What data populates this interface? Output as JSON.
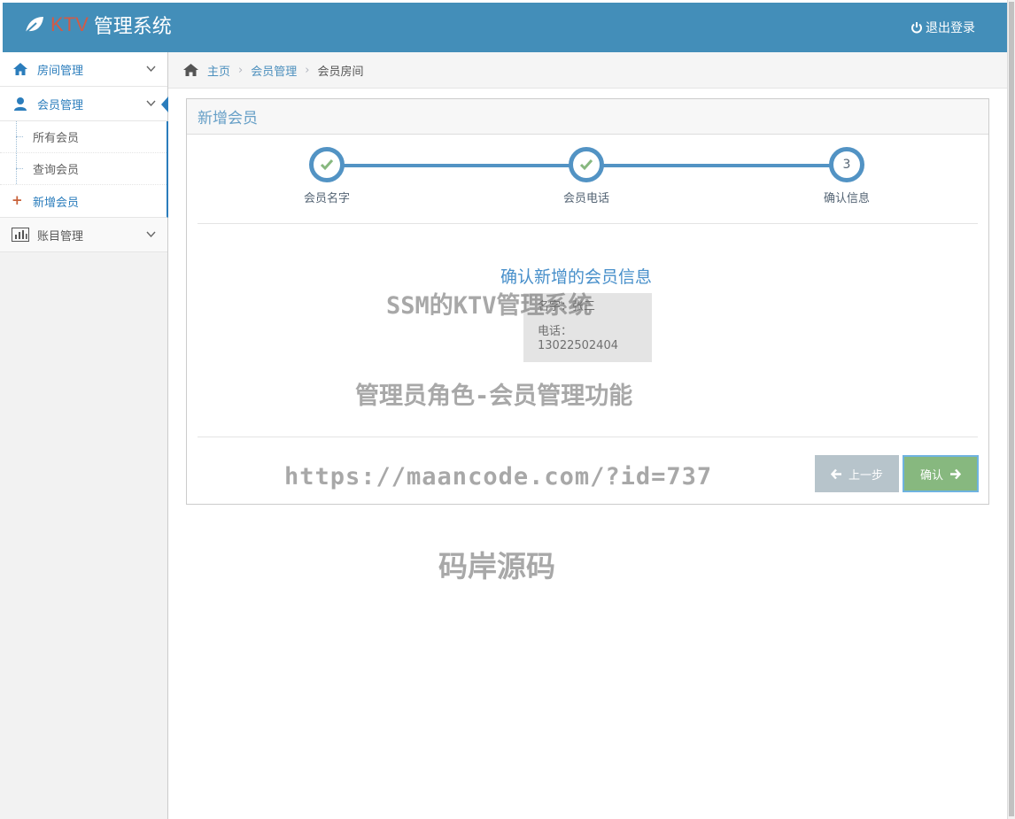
{
  "header": {
    "brand_prefix": "KTV",
    "brand_title": "管理系统",
    "logout_label": "退出登录"
  },
  "sidebar": {
    "rooms": {
      "label": "房间管理"
    },
    "members": {
      "label": "会员管理",
      "items": [
        {
          "label": "所有会员"
        },
        {
          "label": "查询会员"
        },
        {
          "label": "新增会员"
        }
      ]
    },
    "accounts": {
      "label": "账目管理"
    }
  },
  "breadcrumb": {
    "home": "主页",
    "section": "会员管理",
    "current": "会员房间"
  },
  "widget": {
    "title": "新增会员",
    "steps": [
      {
        "label": "会员名字",
        "state": "complete"
      },
      {
        "label": "会员电话",
        "state": "complete"
      },
      {
        "label": "确认信息",
        "state": "active",
        "number": "3"
      }
    ],
    "confirm_title": "确认新增的会员信息",
    "name_line": "名字：张三",
    "phone_label": "电话：",
    "phone_value": "13022502404",
    "prev_button": "上一步",
    "confirm_button": "确认"
  },
  "watermarks": {
    "line1": "SSM的KTV管理系统",
    "line2": "管理员角色-会员管理功能",
    "line3": "https://maancode.com/?id=737",
    "line4": "码岸源码"
  },
  "colors": {
    "navbar": "#438eb9",
    "accent": "#2b7dbc",
    "step": "#5293c4",
    "check": "#87b87f",
    "confirm_button": "#87b87f",
    "prev_button": "#abbac3"
  }
}
